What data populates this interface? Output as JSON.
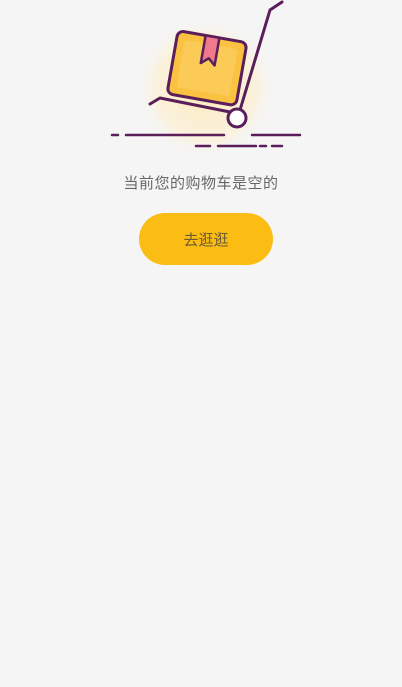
{
  "empty_cart": {
    "message": "当前您的购物车是空的",
    "button_label": "去逛逛",
    "illustration_icon": "empty-cart-trolley-icon"
  },
  "colors": {
    "background": "#f5f5f5",
    "button": "#fbbd14",
    "button_text": "#6b5a34",
    "message_text": "#666666",
    "illustration_outline": "#5a1f5a",
    "box_fill": "#fbc242",
    "tape": "#f07a8c"
  }
}
